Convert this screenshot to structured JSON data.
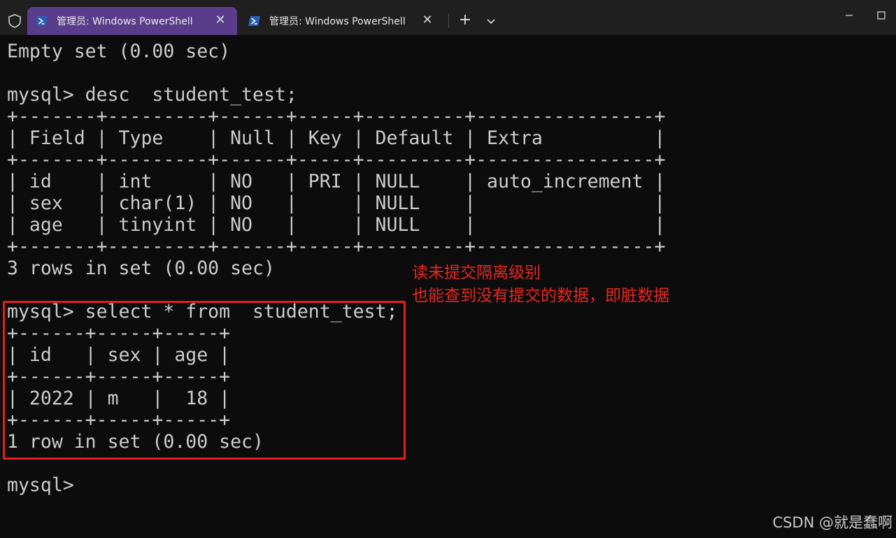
{
  "window": {
    "tabs": [
      {
        "title": "管理员: Windows PowerShell",
        "active": true
      },
      {
        "title": "管理员: Windows PowerShell",
        "active": false
      }
    ],
    "new_tab_label": "+",
    "colors": {
      "active_tab": "#5a3d8a",
      "titlebar": "#1f1f1f",
      "terminal_bg": "#0c0c0c",
      "annotation": "#e8261f"
    }
  },
  "terminal": {
    "lines": [
      "Empty set (0.00 sec)",
      "",
      "mysql> desc  student_test;",
      "+-------+---------+------+-----+---------+----------------+",
      "| Field | Type    | Null | Key | Default | Extra          |",
      "+-------+---------+------+-----+---------+----------------+",
      "| id    | int     | NO   | PRI | NULL    | auto_increment |",
      "| sex   | char(1) | NO   |     | NULL    |                |",
      "| age   | tinyint | NO   |     | NULL    |                |",
      "+-------+---------+------+-----+---------+----------------+",
      "3 rows in set (0.00 sec)",
      "",
      "mysql> select * from  student_test;",
      "+------+-----+-----+",
      "| id   | sex | age |",
      "+------+-----+-----+",
      "| 2022 | m   |  18 |",
      "+------+-----+-----+",
      "1 row in set (0.00 sec)",
      "",
      "mysql>"
    ]
  },
  "annotation": {
    "line1": "读未提交隔离级别",
    "line2": "也能查到没有提交的数据，即脏数据"
  },
  "watermark": "CSDN @就是蠢啊"
}
